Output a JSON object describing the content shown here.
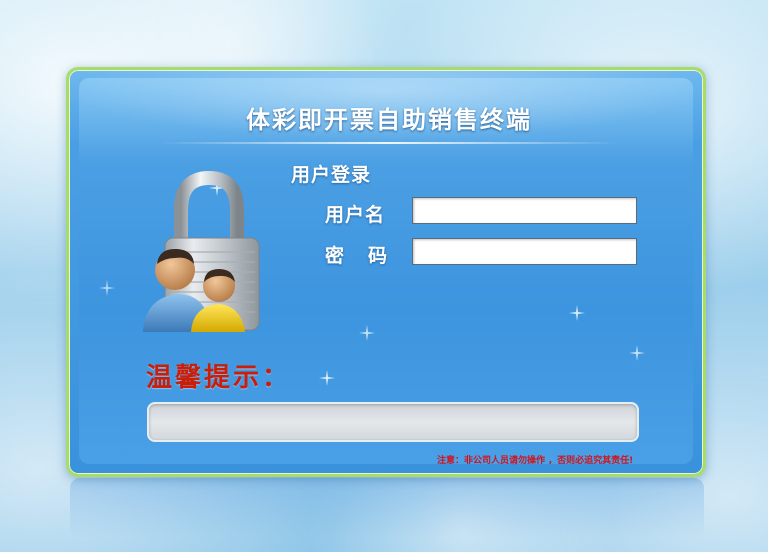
{
  "app": {
    "title": "体彩即开票自助销售终端"
  },
  "login": {
    "section_label": "用户登录",
    "username_label": "用户名",
    "username_value": "",
    "password_label": "密码",
    "password_value": ""
  },
  "tips": {
    "label": "温馨提示：",
    "message": ""
  },
  "notice": {
    "text": "注意：非公司人员请勿操作 ，否则必追究其责任!"
  },
  "icons": {
    "lock": "padlock-with-users-icon"
  },
  "colors": {
    "panel_border": "#a8dc6a",
    "panel_blue": "#3d95df",
    "tip_red": "#c81e0a",
    "notice_red": "#d0141e"
  }
}
